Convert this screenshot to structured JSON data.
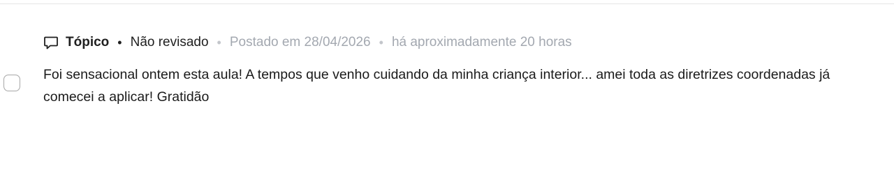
{
  "post": {
    "type_label": "Tópico",
    "type_icon": "speech-bubble-icon",
    "separator": "•",
    "status_label": "Não revisado",
    "posted_label": "Postado em 28/04/2026",
    "relative_time": "há aproximadamente 20 horas",
    "body": "Foi sensacional ontem esta aula! A tempos que venho cuidando da minha criança interior... amei toda as diretrizes coordenadas já comecei a aplicar! Gratidão"
  },
  "colors": {
    "text": "#1f1f1f",
    "muted": "#a3a8b0",
    "checkbox_border": "#a7a7a7"
  }
}
